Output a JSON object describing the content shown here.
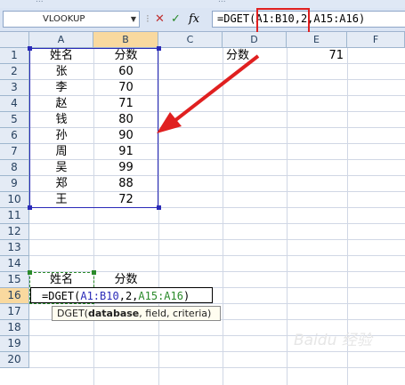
{
  "ribbon": {
    "partial_labels": [
      "...",
      "..."
    ]
  },
  "formula_bar": {
    "name_box": "VLOOKUP",
    "cancel_icon": "✕",
    "enter_icon": "✓",
    "fx_label": "fx",
    "formula_prefix": "=DGET(",
    "formula_range": "A1:B10",
    "formula_rest": ",2,A15:A16)"
  },
  "columns": [
    "A",
    "B",
    "C",
    "D",
    "E",
    "F"
  ],
  "rows": [
    "1",
    "2",
    "3",
    "4",
    "5",
    "6",
    "7",
    "8",
    "9",
    "10",
    "11",
    "12",
    "13",
    "14",
    "15",
    "16",
    "17",
    "18",
    "19",
    "20"
  ],
  "table": {
    "header_name": "姓名",
    "header_score": "分数",
    "names": [
      "张",
      "李",
      "赵",
      "钱",
      "孙",
      "周",
      "吴",
      "郑",
      "王"
    ],
    "scores": [
      "60",
      "70",
      "71",
      "80",
      "90",
      "91",
      "99",
      "88",
      "72"
    ]
  },
  "lookup": {
    "label": "分数",
    "result": "71"
  },
  "criteria": {
    "name_label": "姓名",
    "score_label": "分数"
  },
  "edit": {
    "prefix": "=DGET(",
    "range": "A1:B10",
    "mid": ",2,",
    "criteria_range": "A15:A16",
    "suffix": ")"
  },
  "tooltip": {
    "fn": "DGET(",
    "arg1": "database",
    "rest": ", field, criteria)"
  },
  "colors": {
    "range_blue": "#2a2ab8",
    "criteria_green": "#2a8a2a",
    "callout_red": "#e02020"
  },
  "watermark": "Baidu 经验"
}
